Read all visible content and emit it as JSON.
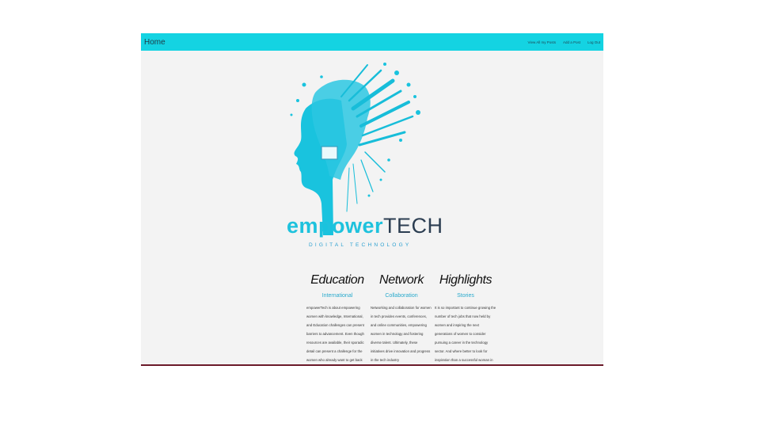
{
  "navbar": {
    "brand": "Home",
    "links": [
      "View All my Posts",
      "Add a Post",
      "Log Out"
    ]
  },
  "logo": {
    "word1": "empower",
    "word2": "TECH",
    "tagline": "DIGITAL TECHNOLOGY"
  },
  "columns": [
    {
      "title": "Education",
      "subtitle": "International",
      "body": "empowerTech is about empowering women with knowledge, International, and Education challenges can present barriers to advancement. Even though resources are available, their sporadic detail can present a challenge for the women who already want to get back"
    },
    {
      "title": "Network",
      "subtitle": "Collaboration",
      "body": "Networking and collaboration for women in tech provides events, conferences, and online communities, empowering women in technology and fostering diverse talent. Ultimately, these initiatives drive innovation and progress in the tech industry"
    },
    {
      "title": "Highlights",
      "subtitle": "Stories",
      "body": "It is so important to continue growing the number of tech jobs that now held by women and inspiring the next generations of women to consider pursuing a career in the technology sector. And where better to look for inspiration than a successful woman in"
    }
  ],
  "colors": {
    "navbar": "#14d3e2",
    "accent": "#1ec2dd",
    "dark": "#2c3e52"
  }
}
